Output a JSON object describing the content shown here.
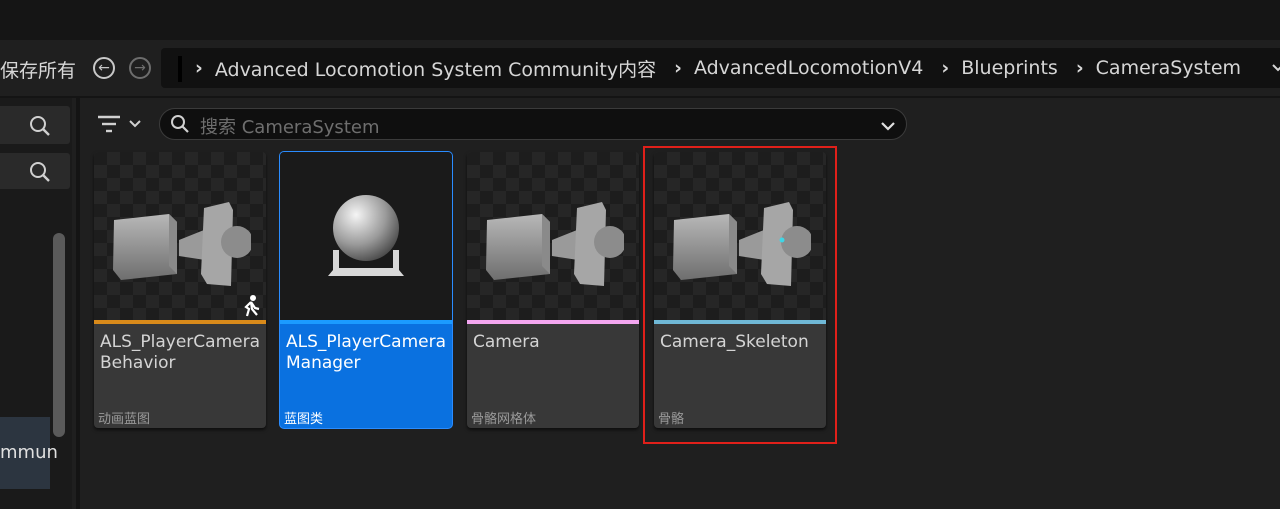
{
  "toolbar": {
    "save_all_label": "保存所有"
  },
  "nav": {
    "back_icon": "arrow-left-circle-icon",
    "forward_icon": "arrow-right-circle-icon"
  },
  "breadcrumbs": [
    "Advanced Locomotion System Community内容",
    "AdvancedLocomotionV4",
    "Blueprints",
    "CameraSystem"
  ],
  "search": {
    "placeholder": "搜索 CameraSystem"
  },
  "tree": {
    "visible_item_label": "mmun"
  },
  "assets": [
    {
      "name": "ALS_PlayerCamera Behavior",
      "type": "动画蓝图",
      "color": "#d98a1a",
      "selected": false,
      "highlighted": false
    },
    {
      "name": "ALS_PlayerCamera Manager",
      "type": "蓝图类",
      "color": "#1b9bff",
      "selected": true,
      "highlighted": false
    },
    {
      "name": "Camera",
      "type": "骨骼网格体",
      "color": "#f3a6f0",
      "selected": false,
      "highlighted": false
    },
    {
      "name": "Camera_Skeleton",
      "type": "骨骼",
      "color": "#6fb8d6",
      "selected": false,
      "highlighted": true
    }
  ],
  "colors": {
    "highlight": "#e0201a",
    "selection": "#0a71e0"
  }
}
